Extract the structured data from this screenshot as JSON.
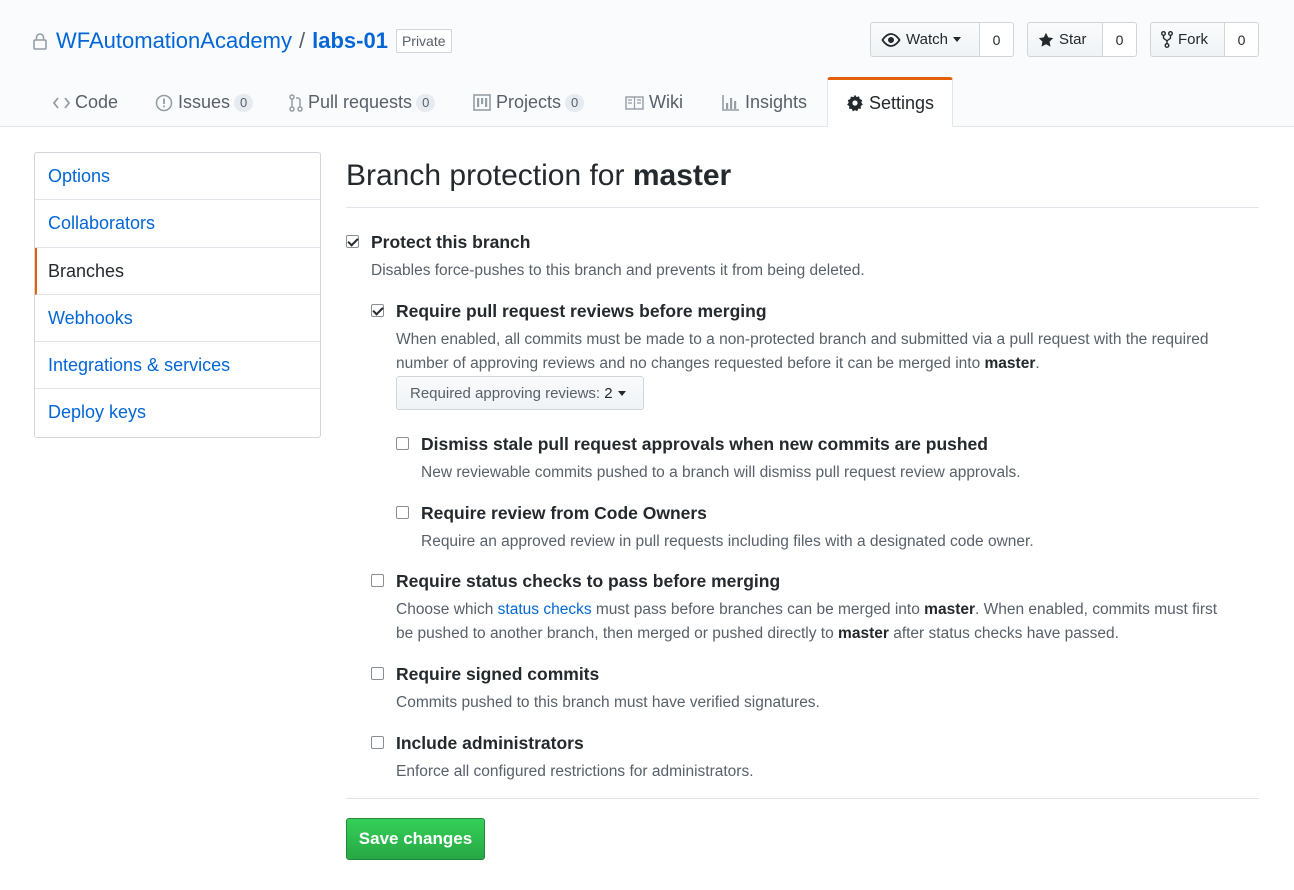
{
  "repo": {
    "owner": "WFAutomationAcademy",
    "separator": "/",
    "name": "labs-01",
    "visibility": "Private"
  },
  "actions": {
    "watch": {
      "label": "Watch",
      "count": "0"
    },
    "star": {
      "label": "Star",
      "count": "0"
    },
    "fork": {
      "label": "Fork",
      "count": "0"
    }
  },
  "tabs": [
    {
      "label": "Code",
      "icon": "code-icon"
    },
    {
      "label": "Issues",
      "icon": "issue-icon",
      "counter": "0"
    },
    {
      "label": "Pull requests",
      "icon": "pull-request-icon",
      "counter": "0"
    },
    {
      "label": "Projects",
      "icon": "project-icon",
      "counter": "0"
    },
    {
      "label": "Wiki",
      "icon": "book-icon"
    },
    {
      "label": "Insights",
      "icon": "graph-icon"
    },
    {
      "label": "Settings",
      "icon": "gear-icon",
      "selected": true
    }
  ],
  "sidebar": {
    "items": [
      {
        "label": "Options"
      },
      {
        "label": "Collaborators"
      },
      {
        "label": "Branches",
        "selected": true
      },
      {
        "label": "Webhooks"
      },
      {
        "label": "Integrations & services"
      },
      {
        "label": "Deploy keys"
      }
    ]
  },
  "page": {
    "title_prefix": "Branch protection for",
    "branch": "master"
  },
  "options": {
    "protect": {
      "label": "Protect this branch",
      "checked": true,
      "note": "Disables force-pushes to this branch and prevents it from being deleted."
    },
    "reviews": {
      "label": "Require pull request reviews before merging",
      "checked": true,
      "note_line1": "When enabled, all commits must be made to a non-protected branch and submitted via a pull request with the required",
      "note_line2_pre": "number of approving reviews and no changes requested before it can be merged into",
      "note_branch": "master",
      "note_line2_post": ".",
      "select_prefix": "Required approving reviews:",
      "select_value": "2"
    },
    "dismiss": {
      "label": "Dismiss stale pull request approvals when new commits are pushed",
      "checked": false,
      "note": "New reviewable commits pushed to a branch will dismiss pull request review approvals."
    },
    "codeowners": {
      "label": "Require review from Code Owners",
      "checked": false,
      "note": "Require an approved review in pull requests including files with a designated code owner."
    },
    "status": {
      "label": "Require status checks to pass before merging",
      "checked": false,
      "note_a": "Choose which",
      "note_link": "status checks",
      "note_b": "must pass before branches can be merged into",
      "note_branch": "master",
      "note_c": ". When enabled, commits must first",
      "note_line2_a": "be pushed to another branch, then merged or pushed directly to",
      "note_line2_branch": "master",
      "note_line2_b": "after status checks have passed."
    },
    "signed": {
      "label": "Require signed commits",
      "checked": false,
      "note": "Commits pushed to this branch must have verified signatures."
    },
    "admins": {
      "label": "Include administrators",
      "checked": false,
      "note": "Enforce all configured restrictions for administrators."
    }
  },
  "save_label": "Save changes",
  "colors": {
    "link": "#0366d6",
    "accent_tab": "#e36209",
    "save_green": "#28a745"
  }
}
